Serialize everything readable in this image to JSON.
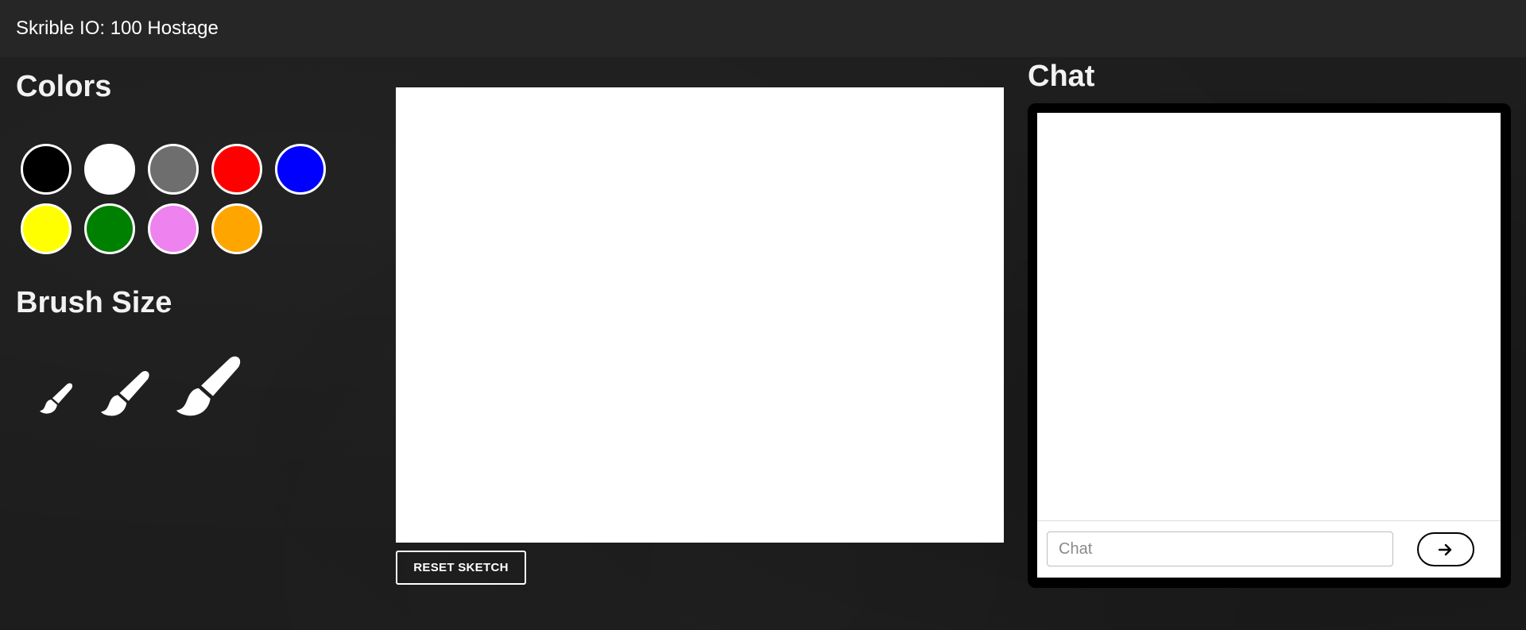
{
  "header": {
    "title": "Skrible IO: 100 Hostage"
  },
  "colors": {
    "heading": "Colors",
    "swatches": [
      {
        "name": "black",
        "hex": "#000000"
      },
      {
        "name": "white",
        "hex": "#ffffff"
      },
      {
        "name": "gray",
        "hex": "#6e6e6e"
      },
      {
        "name": "red",
        "hex": "#ff0000"
      },
      {
        "name": "blue",
        "hex": "#0000ff"
      },
      {
        "name": "yellow",
        "hex": "#ffff00"
      },
      {
        "name": "green",
        "hex": "#008000"
      },
      {
        "name": "violet",
        "hex": "#ee82ee"
      },
      {
        "name": "orange",
        "hex": "#ffa500"
      }
    ]
  },
  "brush": {
    "heading": "Brush Size",
    "sizes": [
      {
        "name": "small",
        "icon": "paint-brush-icon"
      },
      {
        "name": "medium",
        "icon": "paint-brush-icon"
      },
      {
        "name": "large",
        "icon": "paint-brush-icon"
      }
    ]
  },
  "sketch": {
    "reset_label": "RESET SKETCH"
  },
  "chat": {
    "heading": "Chat",
    "input_placeholder": "Chat",
    "input_value": "",
    "send_icon": "arrow-right-icon"
  }
}
